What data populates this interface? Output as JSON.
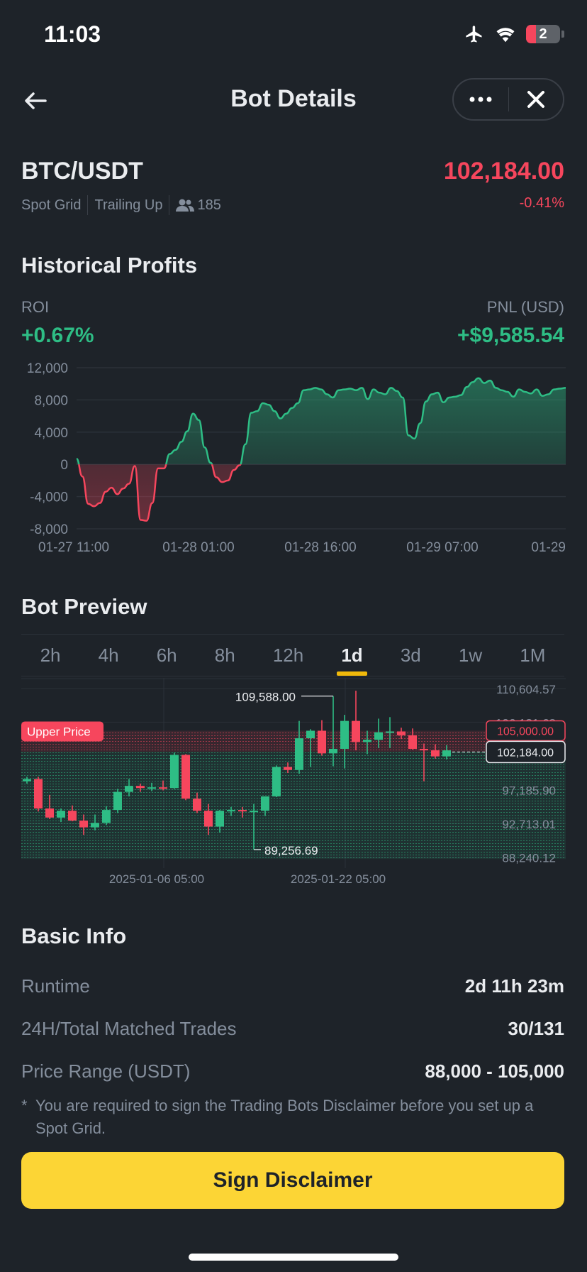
{
  "status_bar": {
    "time": "11:03",
    "battery_level": "2"
  },
  "header": {
    "title": "Bot Details"
  },
  "pair": {
    "symbol": "BTC/USDT",
    "price": "102,184.00",
    "change": "-0.41%",
    "type": "Spot Grid",
    "mode": "Trailing Up",
    "copiers": "185"
  },
  "profits": {
    "title": "Historical Profits",
    "roi_label": "ROI",
    "roi_value": "+0.67%",
    "pnl_label": "PNL (USD)",
    "pnl_value": "+$9,585.54"
  },
  "chart_data": [
    {
      "type": "area",
      "y_ticks": [
        "12,000",
        "8,000",
        "4,000",
        "0",
        "-4,000",
        "-8,000"
      ],
      "x_ticks": [
        "01-27 11:00",
        "01-28 01:00",
        "01-28 16:00",
        "01-29 07:00",
        "01-29"
      ],
      "ylim": [
        -8000,
        12000
      ],
      "series": [
        {
          "values": [
            700,
            -1500,
            -4900,
            -5200,
            -4800,
            -3400,
            -2900,
            -3700,
            -3000,
            -2400,
            -200,
            -6900,
            -7000,
            -4800,
            -500,
            -500,
            1300,
            1800,
            2800,
            4100,
            6300,
            5500,
            2100,
            200,
            -1600,
            -2200,
            -2000,
            -700,
            -100,
            2500,
            6400,
            6600,
            7600,
            7400,
            6600,
            5700,
            6300,
            7000,
            7600,
            9200,
            9300,
            9500,
            9300,
            8700,
            8300,
            9200,
            9300,
            9400,
            9200,
            9500,
            8100,
            9300,
            8900,
            8700,
            9500,
            9100,
            8300,
            3600,
            3200,
            5100,
            7800,
            8700,
            8900,
            7700,
            8300,
            8400,
            8600,
            9600,
            10200,
            10700,
            10100,
            10400,
            9500,
            9200,
            9000,
            8400,
            9300,
            9000,
            8800,
            9300,
            8500,
            8700,
            9300,
            9400,
            9500
          ]
        }
      ]
    },
    {
      "type": "candlestick",
      "y_ticks": [
        "110,604.57",
        "106,131.68",
        "97,185.90",
        "92,713.01",
        "88,240.12"
      ],
      "x_ticks": [
        "2025-01-06 05:00",
        "2025-01-22 05:00"
      ],
      "ylim": [
        86800,
        112000
      ],
      "annotations": {
        "high": "109,588.00",
        "low": "89,256.69",
        "upper_price": "Upper Price",
        "upper_price_value": "105,000.00",
        "current_price": "102,184.00"
      },
      "lower_price": 88000,
      "candles": [
        {
          "o": 98300,
          "h": 98900,
          "l": 98000,
          "c": 98600
        },
        {
          "o": 98600,
          "h": 98900,
          "l": 94300,
          "c": 94700
        },
        {
          "o": 94700,
          "h": 96500,
          "l": 93300,
          "c": 93500
        },
        {
          "o": 93500,
          "h": 94700,
          "l": 92900,
          "c": 94400
        },
        {
          "o": 94400,
          "h": 95100,
          "l": 93000,
          "c": 93100
        },
        {
          "o": 93100,
          "h": 93900,
          "l": 91200,
          "c": 92200
        },
        {
          "o": 92200,
          "h": 93900,
          "l": 91800,
          "c": 92800
        },
        {
          "o": 92800,
          "h": 95000,
          "l": 92500,
          "c": 94500
        },
        {
          "o": 94500,
          "h": 97300,
          "l": 94100,
          "c": 96900
        },
        {
          "o": 96900,
          "h": 98600,
          "l": 96300,
          "c": 97700
        },
        {
          "o": 97700,
          "h": 98000,
          "l": 96900,
          "c": 97400
        },
        {
          "o": 97400,
          "h": 98100,
          "l": 97000,
          "c": 97500
        },
        {
          "o": 97500,
          "h": 98400,
          "l": 97100,
          "c": 97400
        },
        {
          "o": 97400,
          "h": 102100,
          "l": 97300,
          "c": 101800
        },
        {
          "o": 101800,
          "h": 101900,
          "l": 95800,
          "c": 96000
        },
        {
          "o": 96000,
          "h": 96800,
          "l": 94100,
          "c": 94400
        },
        {
          "o": 94400,
          "h": 95300,
          "l": 91200,
          "c": 92300
        },
        {
          "o": 92300,
          "h": 94500,
          "l": 91500,
          "c": 94400
        },
        {
          "o": 94500,
          "h": 94900,
          "l": 93700,
          "c": 94500
        },
        {
          "o": 94500,
          "h": 94900,
          "l": 93500,
          "c": 94400
        },
        {
          "o": 94400,
          "h": 95300,
          "l": 89257,
          "c": 94400
        },
        {
          "o": 94400,
          "h": 96300,
          "l": 93700,
          "c": 96300
        },
        {
          "o": 96300,
          "h": 100400,
          "l": 96200,
          "c": 100200
        },
        {
          "o": 100200,
          "h": 100800,
          "l": 99400,
          "c": 99800
        },
        {
          "o": 99800,
          "h": 106300,
          "l": 99300,
          "c": 104000
        },
        {
          "o": 104000,
          "h": 105200,
          "l": 100200,
          "c": 105000
        },
        {
          "o": 105000,
          "h": 106400,
          "l": 101700,
          "c": 102000
        },
        {
          "o": 102000,
          "h": 109588,
          "l": 100300,
          "c": 102600
        },
        {
          "o": 102600,
          "h": 107100,
          "l": 100000,
          "c": 106300
        },
        {
          "o": 106300,
          "h": 110300,
          "l": 102400,
          "c": 103500
        },
        {
          "o": 103500,
          "h": 105000,
          "l": 101900,
          "c": 103800
        },
        {
          "o": 103800,
          "h": 106600,
          "l": 102700,
          "c": 104800
        },
        {
          "o": 104800,
          "h": 106800,
          "l": 102700,
          "c": 104900
        },
        {
          "o": 104900,
          "h": 105400,
          "l": 103900,
          "c": 104400
        },
        {
          "o": 104400,
          "h": 105300,
          "l": 102500,
          "c": 102600
        },
        {
          "o": 102600,
          "h": 103300,
          "l": 98300,
          "c": 102400
        },
        {
          "o": 102400,
          "h": 103200,
          "l": 101300,
          "c": 101600
        },
        {
          "o": 101600,
          "h": 103100,
          "l": 101200,
          "c": 102400
        }
      ]
    }
  ],
  "preview": {
    "title": "Bot Preview",
    "tabs": [
      "2h",
      "4h",
      "6h",
      "8h",
      "12h",
      "1d",
      "3d",
      "1w",
      "1M"
    ],
    "active_tab": "1d"
  },
  "basic_info": {
    "title": "Basic Info",
    "runtime_label": "Runtime",
    "runtime_value": "2d 11h 23m",
    "trades_label": "24H/Total Matched Trades",
    "trades_value": "30/131",
    "range_label": "Price Range (USDT)",
    "range_value": "88,000 - 105,000"
  },
  "disclaimer": {
    "star": "*",
    "note": "You are required to sign the Trading Bots Disclaimer before you set up a Spot Grid.",
    "button": "Sign Disclaimer"
  },
  "colors": {
    "bg": "#1e2329",
    "up": "#2ebd85",
    "down": "#f6465d",
    "accent": "#fcd535",
    "muted": "#848e9c"
  }
}
